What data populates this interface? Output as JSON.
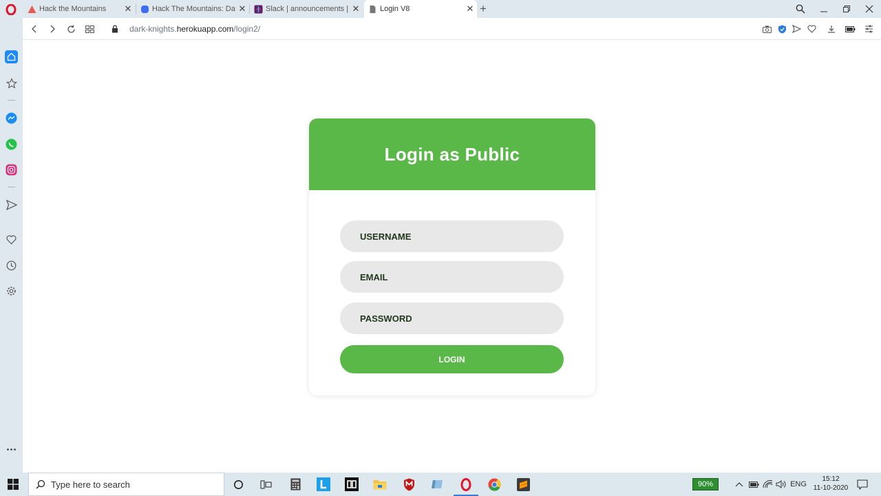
{
  "browser": {
    "tabs": [
      {
        "title": "Hack the Mountains",
        "favicon": "mountain-favicon",
        "active": false
      },
      {
        "title": "Hack The Mountains: Dash",
        "favicon": "blue-shape-favicon",
        "active": false
      },
      {
        "title": "Slack | announcements | Ha",
        "favicon": "slack-favicon",
        "active": false
      },
      {
        "title": "Login V8",
        "favicon": "page-favicon",
        "active": true
      }
    ],
    "address": {
      "prefix": "dark-knights.",
      "host": "herokuapp.com",
      "path": "/login2/"
    }
  },
  "login_card": {
    "title": "Login as Public",
    "username_placeholder": "USERNAME",
    "email_placeholder": "EMAIL",
    "password_placeholder": "PASSWORD",
    "login_label": "LOGIN",
    "accent_color": "#59b847"
  },
  "taskbar": {
    "search_placeholder": "Type here to search",
    "battery": "90%",
    "language": "ENG",
    "time": "15:12",
    "date": "11-10-2020"
  }
}
